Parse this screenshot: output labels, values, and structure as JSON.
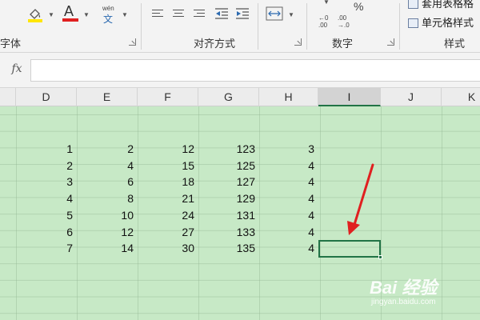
{
  "ribbon": {
    "groups": {
      "font_label": "字体",
      "alignment_label": "对齐方式",
      "number_label": "数字",
      "styles_label": "样式"
    },
    "wen_icon_top": "wén",
    "wen_icon_bottom": "文",
    "font_color_letter": "A",
    "number_format_symbol": "%",
    "styles": {
      "table_format_label": "套用表格格",
      "cell_styles_label": "单元格样式"
    },
    "colors": {
      "fill_highlight": "#ffe600",
      "font_color_underline": "#e02020"
    }
  },
  "formula_bar": {
    "fx_label": "fx",
    "value": ""
  },
  "columns": [
    {
      "label": "D",
      "active": false
    },
    {
      "label": "E",
      "active": false
    },
    {
      "label": "F",
      "active": false
    },
    {
      "label": "G",
      "active": false
    },
    {
      "label": "H",
      "active": false
    },
    {
      "label": "I",
      "active": true
    },
    {
      "label": "J",
      "active": false
    },
    {
      "label": "K",
      "active": false
    }
  ],
  "cells": {
    "D": [
      "1",
      "2",
      "3",
      "4",
      "5",
      "6",
      "7"
    ],
    "E": [
      "2",
      "4",
      "6",
      "8",
      "10",
      "12",
      "14"
    ],
    "F": [
      "12",
      "15",
      "18",
      "21",
      "24",
      "27",
      "30"
    ],
    "G": [
      "123",
      "125",
      "127",
      "129",
      "131",
      "133",
      "135"
    ],
    "H": [
      "3",
      "4",
      "4",
      "4",
      "4",
      "4",
      "4"
    ]
  },
  "selected_cell": "I7",
  "grid_colors": {
    "background": "#c7e9c6",
    "selection": "#217346",
    "annotation_arrow": "#e02020"
  },
  "watermark": {
    "brand": "Bai 经验",
    "url": "jingyan.baidu.com"
  }
}
